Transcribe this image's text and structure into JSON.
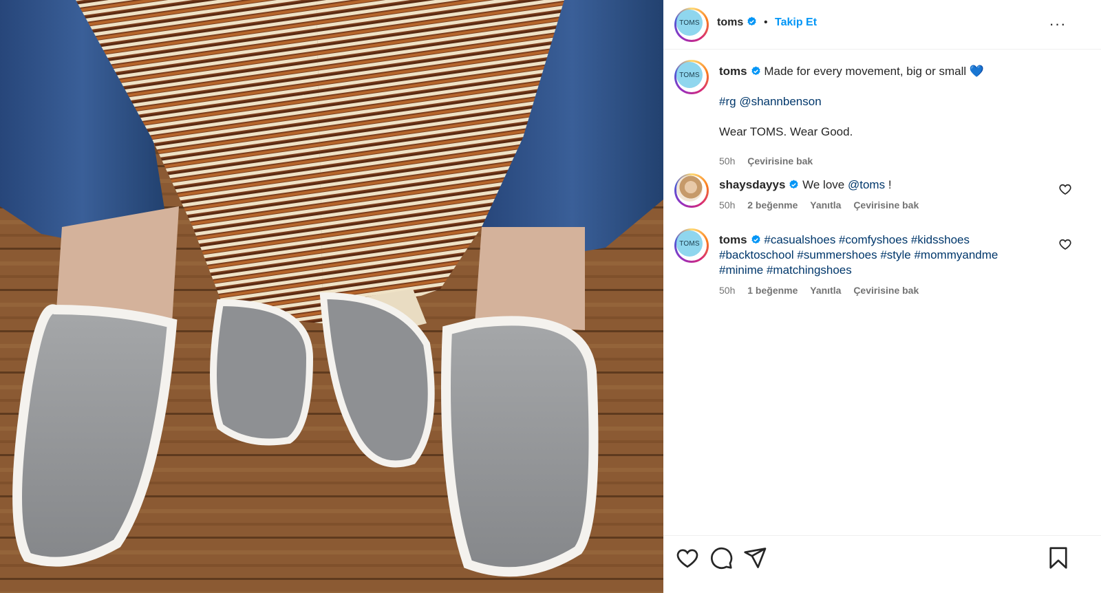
{
  "header": {
    "avatar_text": "TOMS",
    "username": "toms",
    "separator": "•",
    "follow_label": "Takip Et",
    "more_label": "···"
  },
  "caption": {
    "avatar_text": "TOMS",
    "username": "toms",
    "line1": "Made for every movement, big or small 💙",
    "hashtag": "#rg",
    "mention": "@shannbenson",
    "line3": "Wear TOMS. Wear Good.",
    "time": "50h",
    "translate": "Çevirisine bak"
  },
  "comments": [
    {
      "username": "shaysdayys",
      "text_before": "We love",
      "mention": "@toms",
      "text_after": "!",
      "time": "50h",
      "likes": "2 beğenme",
      "reply": "Yanıtla",
      "translate": "Çevirisine bak"
    },
    {
      "avatar_text": "TOMS",
      "username": "toms",
      "tags_line1": "#casualshoes #comfyshoes #kidsshoes",
      "tags_line2": "#backtoschool #summershoes #style #mommyandme",
      "tags_line3": "#minime #matchingshoes",
      "time": "50h",
      "likes": "1 beğenme",
      "reply": "Yanıtla",
      "translate": "Çevirisine bak"
    }
  ],
  "actions": {
    "icons": [
      "heart-icon",
      "comment-icon",
      "share-icon",
      "bookmark-icon"
    ]
  },
  "colors": {
    "link": "#00376b",
    "follow": "#0095f6",
    "verified": "#0095f6",
    "meta": "#737373"
  }
}
